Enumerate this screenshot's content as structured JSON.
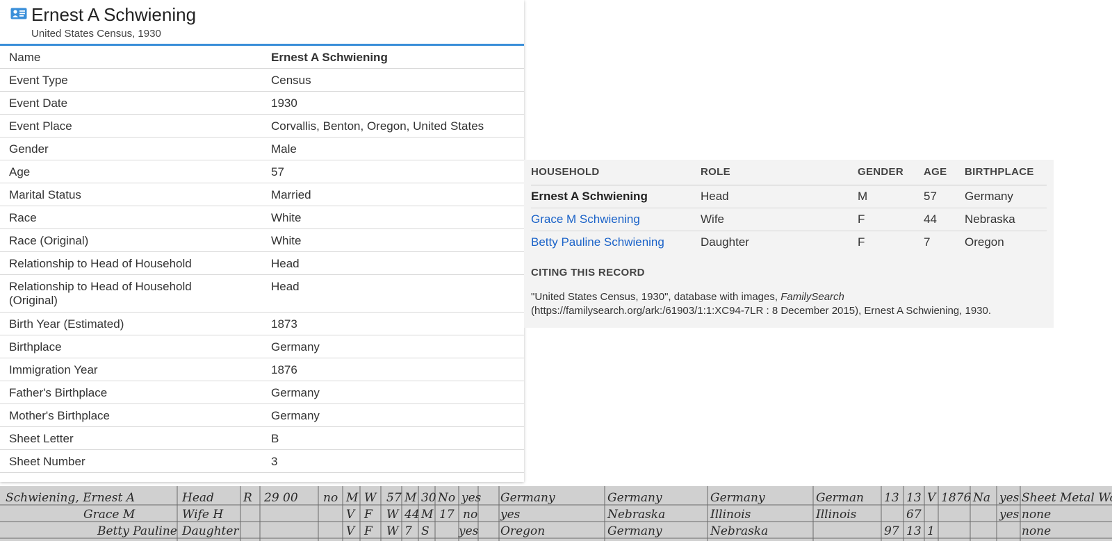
{
  "record": {
    "title": "Ernest A Schwiening",
    "subtitle": "United States Census, 1930",
    "fields": [
      {
        "label": "Name",
        "value": "Ernest A Schwiening"
      },
      {
        "label": "Event Type",
        "value": "Census"
      },
      {
        "label": "Event Date",
        "value": "1930"
      },
      {
        "label": "Event Place",
        "value": "Corvallis, Benton, Oregon, United States"
      },
      {
        "label": "Gender",
        "value": "Male"
      },
      {
        "label": "Age",
        "value": "57"
      },
      {
        "label": "Marital Status",
        "value": "Married"
      },
      {
        "label": "Race",
        "value": "White"
      },
      {
        "label": "Race (Original)",
        "value": "White"
      },
      {
        "label": "Relationship to Head of Household",
        "value": "Head"
      },
      {
        "label": "Relationship to Head of Household (Original)",
        "value": "Head"
      },
      {
        "label": "Birth Year (Estimated)",
        "value": "1873"
      },
      {
        "label": "Birthplace",
        "value": "Germany"
      },
      {
        "label": "Immigration Year",
        "value": "1876"
      },
      {
        "label": "Father's Birthplace",
        "value": "Germany"
      },
      {
        "label": "Mother's Birthplace",
        "value": "Germany"
      },
      {
        "label": "Sheet Letter",
        "value": "B"
      },
      {
        "label": "Sheet Number",
        "value": "3"
      }
    ]
  },
  "household": {
    "columns": [
      "HOUSEHOLD",
      "ROLE",
      "GENDER",
      "AGE",
      "BIRTHPLACE"
    ],
    "members": [
      {
        "name": "Ernest A Schwiening",
        "role": "Head",
        "gender": "M",
        "age": "57",
        "birthplace": "Germany"
      },
      {
        "name": "Grace M Schwiening",
        "role": "Wife",
        "gender": "F",
        "age": "44",
        "birthplace": "Nebraska"
      },
      {
        "name": "Betty Pauline Schwiening",
        "role": "Daughter",
        "gender": "F",
        "age": "7",
        "birthplace": "Oregon"
      }
    ]
  },
  "citation": {
    "heading": "CITING THIS RECORD",
    "text_before": "\"United States Census, 1930\", database with images, ",
    "source": "FamilySearch",
    "text_after": " (https://familysearch.org/ark:/61903/1:1:XC94-7LR : 8 December 2015), Ernest A Schwiening, 1930."
  },
  "census_image": {
    "rows": [
      [
        "Schwiening, Ernest A",
        "Head",
        "R",
        "29 00",
        "no",
        "M",
        "W",
        "57",
        "M",
        "30",
        "No",
        "yes",
        "Germany",
        "Germany",
        "Germany",
        "German",
        "13",
        "13",
        "V",
        "1876",
        "Na",
        "yes",
        "Sheet Metal Worker"
      ],
      [
        "Grace M",
        "Wife H",
        "",
        "",
        "",
        "V",
        "F",
        "W",
        "44",
        "M",
        "17",
        "no",
        "yes",
        "Nebraska",
        "Illinois",
        "Illinois",
        "",
        "67",
        "",
        "yes",
        "none"
      ],
      [
        "Betty Pauline",
        "Daughter",
        "",
        "",
        "",
        "V",
        "F",
        "W",
        "7",
        "S",
        "yes",
        "Oregon",
        "Germany",
        "Nebraska",
        "",
        "97",
        "13",
        "1",
        "none"
      ]
    ]
  },
  "colors": {
    "accent": "#3a8fd9",
    "link": "#1a62c8",
    "panel_bg": "#f3f3f3"
  }
}
